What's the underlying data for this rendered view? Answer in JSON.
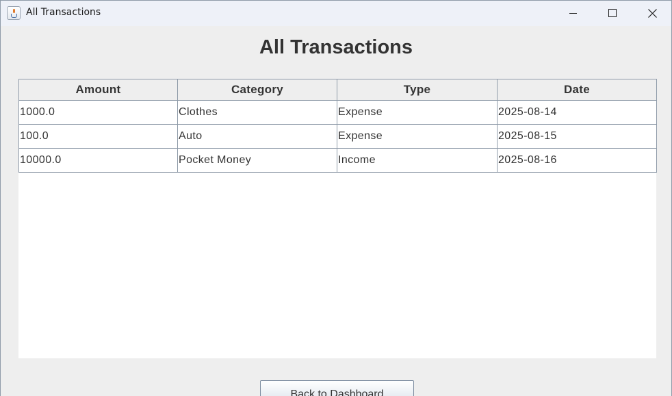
{
  "window": {
    "title": "All Transactions",
    "icon": "java-cup-icon"
  },
  "heading": "All Transactions",
  "table": {
    "columns": [
      "Amount",
      "Category",
      "Type",
      "Date"
    ],
    "rows": [
      [
        "1000.0",
        "Clothes",
        "Expense",
        "2025-08-14"
      ],
      [
        "100.0",
        "Auto",
        "Expense",
        "2025-08-15"
      ],
      [
        "10000.0",
        "Pocket Money",
        "Income",
        "2025-08-16"
      ]
    ]
  },
  "back_button": "Back to Dashboard"
}
